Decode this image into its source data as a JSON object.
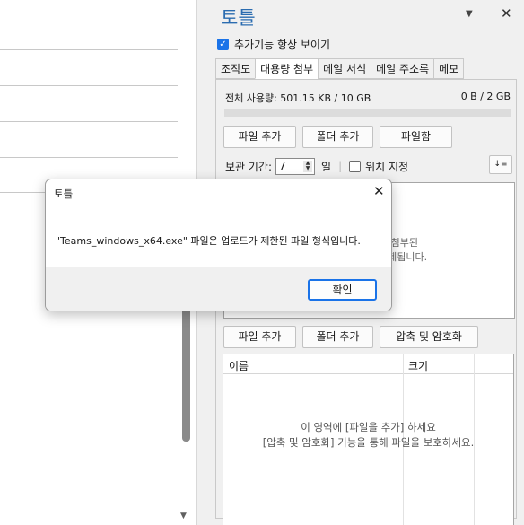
{
  "panel": {
    "title": "토틀",
    "dropdown_icon": "▼",
    "close_icon": "✕",
    "always_show_label": "추가기능 항상 보이기",
    "tabs": [
      "조직도",
      "대용량 첨부",
      "메일 서식",
      "메일 주소록",
      "메모"
    ],
    "active_tab": "대용량 첨부"
  },
  "attach": {
    "usage_label": "전체 사용량: 501.15 KB / 10 GB",
    "usage_right": "0 B / 2 GB",
    "usage_fraction": 0.05,
    "buttons_top": [
      "파일 추가",
      "폴더 추가",
      "파일함"
    ],
    "keep_label": "보관 기간:",
    "keep_value": "7",
    "keep_unit": "일",
    "location_label": "위치 지정",
    "sort_icon": "↓≡",
    "drop_hint_1": "우 첨부된",
    "drop_hint_2": "삭제됩니다.",
    "buttons_bottom": [
      "파일 추가",
      "폴더 추가",
      "압축 및 암호화"
    ],
    "col_name": "이름",
    "col_size": "크기",
    "empty_line_1": "이 영역에 [파일을 추가] 하세요",
    "empty_line_2": "[압축 및 암호화] 기능을 통해 파일을 보호하세요."
  },
  "dialog": {
    "title": "토틀",
    "close_icon": "✕",
    "message": "\"Teams_windows_x64.exe\" 파일은 업로드가 제한된 파일 형식입니다.",
    "ok_label": "확인"
  },
  "scrollbar": {
    "arrow": "▼"
  },
  "colors": {
    "accent": "#1a73e8",
    "title_blue": "#2b6cb0"
  }
}
